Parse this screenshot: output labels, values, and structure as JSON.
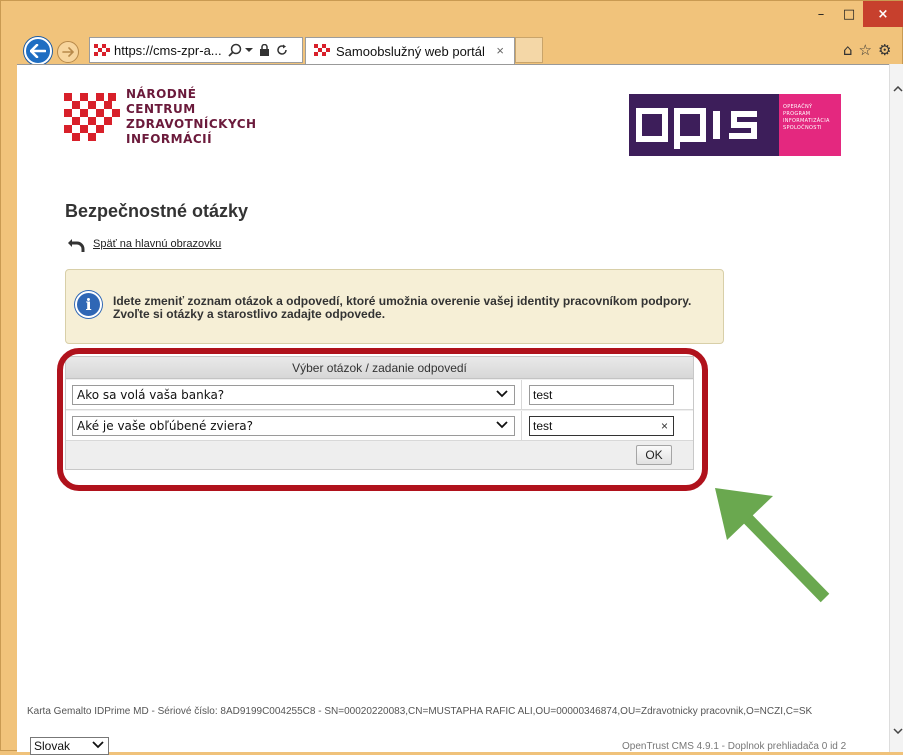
{
  "window": {
    "minimize_glyph": "–",
    "maximize_glyph": "□",
    "close_glyph": "×"
  },
  "browser": {
    "address": "https://cms-zpr-a...",
    "tab_title": "Samoobslužný web portál",
    "tab_close": "×"
  },
  "header": {
    "logo_lines": [
      "NÁRODNÉ",
      "CENTRUM",
      "ZDRAVOTNÍCKYCH",
      "INFORMÁCIÍ"
    ],
    "opis_lines": [
      "OPERAČNÝ",
      "PROGRAM",
      "INFORMATIZÁCIA",
      "SPOLOČNOSTI"
    ]
  },
  "page": {
    "title": "Bezpečnostné otázky",
    "back_link": "Späť na hlavnú obrazovku"
  },
  "info": {
    "line1": "Idete zmeniť zoznam otázok a odpovedí, ktoré umožnia overenie vašej identity pracovníkom podpory.",
    "line2": "Zvoľte si otázky a starostlivo zadajte odpovede."
  },
  "questions": {
    "header": "Výber otázok / zadanie odpovedí",
    "rows": [
      {
        "question": "Ako sa volá vaša banka?",
        "answer": "test"
      },
      {
        "question": "Aké je vaše obľúbené zviera?",
        "answer": "test"
      }
    ],
    "ok_label": "OK"
  },
  "footer": {
    "card_info": "Karta Gemalto IDPrime MD - Sériové číslo: 8AD9199C004255C8 - SN=00020220083,CN=MUSTAPHA RAFIC ALI,OU=00000346874,OU=Zdravotnicky pracovnik,O=NCZI,C=SK",
    "language": "Slovak",
    "version": "OpenTrust CMS 4.9.1 - Doplnok prehliadača 0 id 2"
  },
  "colors": {
    "highlight_border": "#b0121c",
    "arrow": "#6aa84f",
    "logo_red": "#d8202a",
    "opis_purple": "#3d1e5a",
    "opis_pink": "#e4287f"
  }
}
